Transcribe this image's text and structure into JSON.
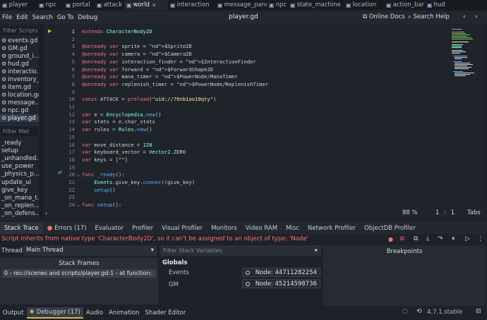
{
  "tabs": [
    {
      "label": "player",
      "icon": "script-icon"
    },
    {
      "label": "npc",
      "icon": "script-icon"
    },
    {
      "label": "portal",
      "icon": "script-icon"
    },
    {
      "label": "attack",
      "icon": "script-icon"
    },
    {
      "label": "world",
      "icon": "scene-icon",
      "active": true
    },
    {
      "label": "interaction",
      "icon": "script-icon"
    },
    {
      "label": "message_panel",
      "icon": "script-icon"
    },
    {
      "label": "npc",
      "icon": "script-icon"
    },
    {
      "label": "state_machine",
      "icon": "script-icon"
    },
    {
      "label": "location",
      "icon": "script-icon"
    },
    {
      "label": "action_bar",
      "icon": "script-icon"
    },
    {
      "label": "hud",
      "icon": "script-icon"
    }
  ],
  "menu": [
    "File",
    "Edit",
    "Search",
    "Go To",
    "Debug"
  ],
  "file_title": "player.gd",
  "online_docs": "Online Docs",
  "search_help": "Search Help",
  "filter_scripts": "Filter Scripts",
  "scripts": [
    "events.gd",
    "GM.gd",
    "ground_i...",
    "hud.gd",
    "interactio...",
    "inventory_...",
    "item.gd",
    "location.gd",
    "message...",
    "npc.gd",
    "player.gd"
  ],
  "selected_script": "player.gd",
  "filter_methods": "Filter Met",
  "methods": [
    "_ready",
    "setup",
    "_unhandled...",
    "use_power",
    "_physics_p...",
    "update_ui",
    "give_key",
    "_on_mana_t...",
    "_on_replen...",
    "_on_defens..."
  ],
  "code_lines": [
    {
      "n": "1",
      "t": "extends CharacterBody2D"
    },
    {
      "n": "2",
      "t": ""
    },
    {
      "n": "3",
      "t": "@onready var sprite = $Sprite2D"
    },
    {
      "n": "4",
      "t": "@onready var camera = $Camera2D"
    },
    {
      "n": "5",
      "t": "@onready var interaction_finder = $InteractionFinder"
    },
    {
      "n": "6",
      "t": "@onready var forward = $ForwardShape2D"
    },
    {
      "n": "7",
      "t": "@onready var mana_timer = $PowerNode/ManaTimer"
    },
    {
      "n": "8",
      "t": "@onready var replenish_timer = $PowerNode/ReplenishTimer"
    },
    {
      "n": "9",
      "t": ""
    },
    {
      "n": "10",
      "t": "const ATTACK = preload(\"uid://76nb1oo10qty\")"
    },
    {
      "n": "11",
      "t": ""
    },
    {
      "n": "12",
      "t": "var e = Encyclopedia.new()"
    },
    {
      "n": "13",
      "t": "var stats = e.char_stats"
    },
    {
      "n": "14",
      "t": "var rules = Rules.new()"
    },
    {
      "n": "15",
      "t": ""
    },
    {
      "n": "16",
      "t": "var move_distance = 128"
    },
    {
      "n": "17",
      "t": "var keyboard_vector = Vector2.ZERO"
    },
    {
      "n": "18",
      "t": "var keys = [\"\"]"
    },
    {
      "n": "19",
      "t": ""
    },
    {
      "n": "20",
      "t": "func _ready():"
    },
    {
      "n": "21",
      "t": "    Events.give_key.connect(give_key)"
    },
    {
      "n": "22",
      "t": "    setup()"
    },
    {
      "n": "23",
      "t": ""
    },
    {
      "n": "24",
      "t": "func setup():"
    }
  ],
  "zoom": "88 %",
  "cursor_line": "1",
  "cursor_col": "1",
  "indent_mode": "Tabs",
  "bottom_tabs": [
    "Stack Trace",
    "Errors (17)",
    "Evaluator",
    "Profiler",
    "Visual Profiler",
    "Monitors",
    "Video RAM",
    "Misc",
    "Network Profiler",
    "ObjectDB Profiler"
  ],
  "error_message": "Script inherits from native type 'CharacterBody2D', so it can't be assigned to an object of type: 'Node'",
  "thread_label": "Thread:",
  "thread_value": "Main Thread",
  "stack_frames_title": "Stack Frames",
  "stack_frame": "0 - res://scenes and scripts/player.gd:1 - at function:",
  "filter_stack_vars": "Filter Stack Variables",
  "globals_label": "Globals",
  "globals": [
    {
      "name": "Events",
      "value": "Node: 44711282254"
    },
    {
      "name": "GM",
      "value": "Node: 45214598736"
    }
  ],
  "breakpoints_title": "Breakpoints",
  "status_tabs": [
    "Output",
    "Debugger (17)",
    "Audio",
    "Animation",
    "Shader Editor"
  ],
  "version": "4.7.1.stable",
  "colors": {
    "accent": "#e0b050",
    "error": "#ff6f6f",
    "keyword": "#ff7085",
    "node_path": "#63c259",
    "string": "#ffeda1"
  }
}
